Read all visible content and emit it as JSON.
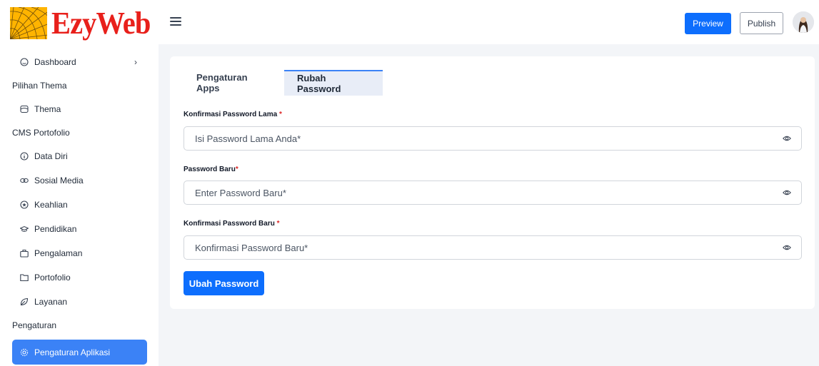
{
  "brand": {
    "name": "EzyWeb",
    "logo_color": "#e8201b",
    "mark_color": "#ffb400"
  },
  "header": {
    "preview_label": "Preview",
    "publish_label": "Publish"
  },
  "sidebar": {
    "dashboard": "Dashboard",
    "section_thema": "Pilihan Thema",
    "thema": "Thema",
    "section_cms": "CMS Portofolio",
    "items": [
      "Data Diri",
      "Sosial Media",
      "Keahlian",
      "Pendidikan",
      "Pengalaman",
      "Portofolio",
      "Layanan"
    ],
    "section_pengaturan": "Pengaturan",
    "active": "Pengaturan Aplikasi"
  },
  "tabs": {
    "apps": "Pengaturan Apps",
    "password": "Rubah Password"
  },
  "form": {
    "old_label": "Konfirmasi Password Lama",
    "old_placeholder": "Isi Password Lama Anda*",
    "new_label": "Password Baru",
    "new_placeholder": "Enter Password Baru*",
    "confirm_label": "Konfirmasi Password Baru",
    "confirm_placeholder": "Konfirmasi Password Baru*",
    "required_mark": "*",
    "submit_label": "Ubah Password"
  },
  "colors": {
    "primary": "#0d6efd",
    "active_nav": "#3b82f6",
    "required": "#dc2626"
  }
}
